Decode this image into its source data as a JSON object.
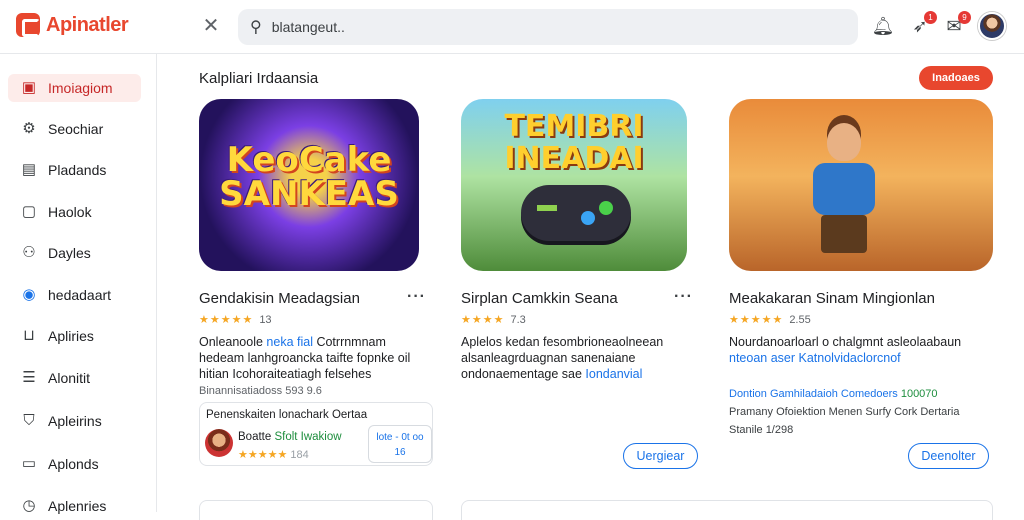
{
  "app": {
    "name": "Apinatler"
  },
  "search": {
    "value": "blatangeut.."
  },
  "header": {
    "icons": [
      "close-icon",
      "search-icon",
      "bell-icon",
      "notification-icon",
      "message-icon"
    ],
    "badges": [
      "1",
      "9"
    ]
  },
  "sidebar": {
    "items": [
      {
        "label": "Imoiagiom",
        "icon": "home-icon",
        "active": true
      },
      {
        "label": "Seochiar",
        "icon": "settings-icon"
      },
      {
        "label": "Pladands",
        "icon": "document-icon"
      },
      {
        "label": "Haolok",
        "icon": "book-icon"
      },
      {
        "label": "Dayles",
        "icon": "user-icon"
      },
      {
        "label": "hedadaart",
        "icon": "globe-icon"
      },
      {
        "label": "Apliries",
        "icon": "inbox-icon"
      },
      {
        "label": "Alonitit",
        "icon": "list-icon"
      },
      {
        "label": "Apleirins",
        "icon": "shield-icon"
      },
      {
        "label": "Aplonds",
        "icon": "folder-icon"
      },
      {
        "label": "Aplenries",
        "icon": "clock-icon"
      }
    ]
  },
  "section": {
    "title": "Kalpliari Irdaansia",
    "see_all": "Inadoaes"
  },
  "cards": [
    {
      "art_title_1": "KeoCake",
      "art_title_2": "SANKEAS",
      "title": "Gendakisin Meadagsian",
      "stars": "★★★★★",
      "rating": "13",
      "desc_line1_a": "Onleanoole ",
      "desc_line1_b": "neka fial",
      "desc_line1_c": " Cotrrnmnam",
      "desc_line2": "hedeam lanhgroancka taifte fopnke oil",
      "desc_line3": "hitian Icohoraiteatiagh felsehes",
      "sub": "Binannisatiadoss 593 9.6",
      "mini": {
        "title": "Penenskaiten lonachark Oertaa",
        "name": "Boatte",
        "name_tag": "Sfolt Iwakiow",
        "stars": "★★★★★",
        "count": "184",
        "box_line1": "lote - 0t oo",
        "box_line2": "16"
      }
    },
    {
      "art_title_1": "TEMIBRI",
      "art_title_2": "INEADAI",
      "title": "Sirplan Camkkin Seana",
      "stars": "★★★★",
      "rating": "7.3",
      "desc_line1": "Aplelos kedan fesombrioneaolneean",
      "desc_line2": "alsanleagrduagnan sanenaiane",
      "desc_line3_a": "ondonaementage sae ",
      "desc_line3_b": "Iondanvial",
      "button": "Uergiear"
    },
    {
      "title": "Meakakaran Sinam Mingionlan",
      "stars": "★★★★★",
      "rating": "2.55",
      "desc_line1": "Nourdanoarloarl o chalgmnt asleolaabaun",
      "desc_line2": "nteoan aser Katnolvidaclorcnof",
      "meta1_a": "Dontion Gamhiladaioh Comedoers",
      "meta1_b": "100070",
      "meta2": "Pramany Ofoiektion Menen Surfy Cork Dertaria",
      "meta3": "Stanile 1/298",
      "button": "Deenolter"
    }
  ],
  "colors": {
    "accent": "#e8472e",
    "link": "#1a73e8",
    "star": "#f5a623"
  }
}
